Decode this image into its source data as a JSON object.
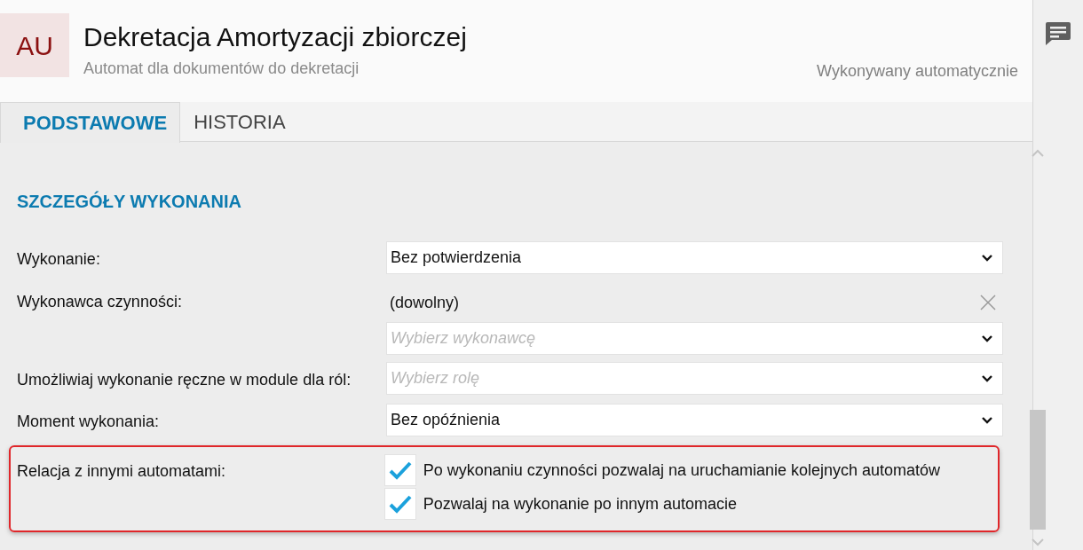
{
  "header": {
    "avatar": "AU",
    "title": "Dekretacja Amortyzacji zbiorczej",
    "subtitle": "Automat dla dokumentów do dekretacji",
    "mode": "Wykonywany automatycznie"
  },
  "tabs": [
    {
      "label": "PODSTAWOWE",
      "selected": true
    },
    {
      "label": "HISTORIA",
      "selected": false
    }
  ],
  "section": {
    "title": "SZCZEGÓŁY WYKONANIA",
    "fields": [
      {
        "kind": "select",
        "label": "Wykonanie:",
        "value": "Bez potwierdzenia"
      },
      {
        "kind": "picker",
        "label": "Wykonawca czynności:",
        "value": "(dowolny)",
        "placeholder": "Wybierz wykonawcę"
      },
      {
        "kind": "select",
        "label": "Umożliwiaj wykonanie ręczne w module dla ról:",
        "placeholder": "Wybierz rolę"
      },
      {
        "kind": "select",
        "label": "Moment wykonania:",
        "value": "Bez opóźnienia"
      },
      {
        "kind": "checks",
        "label": "Relacja z innymi automatami:",
        "highlighted": true,
        "options": [
          {
            "label": "Po wykonaniu czynności pozwalaj na uruchamianie kolejnych automatów",
            "checked": true
          },
          {
            "label": "Pozwalaj na wykonanie po innym automacie",
            "checked": true
          }
        ]
      }
    ]
  }
}
